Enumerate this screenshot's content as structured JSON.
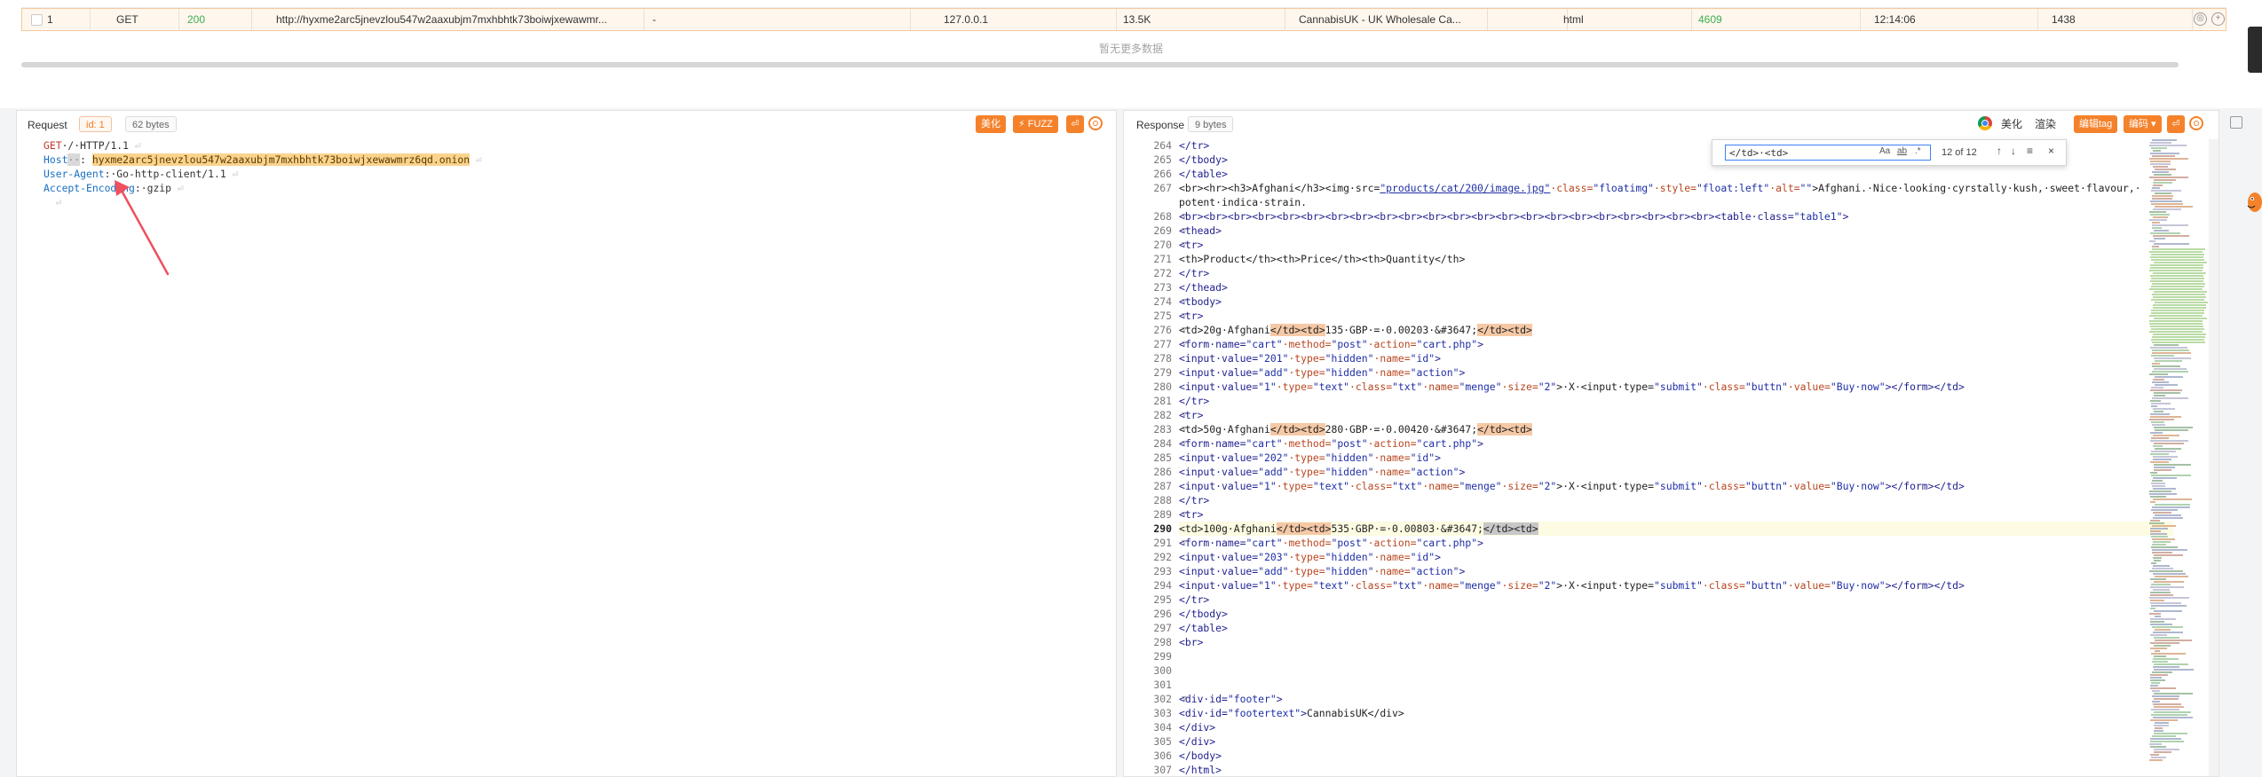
{
  "table": {
    "row": {
      "index": "1",
      "method": "GET",
      "status": "200",
      "url": "http://hyxme2arc5jnevzlou547w2aaxubjm7mxhbhtk73boiwjxewawmr...",
      "extra": "-",
      "ip": "127.0.0.1",
      "size": "13.5K",
      "title": "CannabisUK - UK Wholesale Ca...",
      "content_type": "html",
      "body_len": "4609",
      "time": "12:14:06",
      "duration": "1438"
    },
    "no_more_text": "暂无更多数据"
  },
  "request": {
    "title": "Request",
    "id_tag": "id: 1",
    "size_tag": "62 bytes",
    "beautify": "美化",
    "fuzz": "⚡ FUZZ",
    "lines": {
      "l1_method": "GET",
      "l1_rest": "·/·HTTP/1.1",
      "l2_key": "Host",
      "l2_sep": ":",
      "l2_value": "hyxme2arc5jnevzlou547w2aaxubjm7mxhbhtk73boiwjxewawmrz6qd.onion",
      "l3_key": "User-Agent",
      "l3_value": ":·Go-http-client/1.1",
      "l4_key": "Accept-Encoding",
      "l4_value": ":·gzip"
    }
  },
  "response": {
    "title": "Response",
    "size_tag": "9 bytes",
    "beautify": "美化",
    "render": "渲染",
    "edit_tag": "编辑tag",
    "encode": "编码 ▾",
    "find": {
      "value": "</td>·<td>",
      "case": "Aa",
      "word": "ab",
      "regex": ".*",
      "count": "12 of 12",
      "up": "↑",
      "down": "↓",
      "menu": "≡",
      "close": "×"
    }
  },
  "code_lines": [
    {
      "n": "264",
      "f": "",
      "t": "tag",
      "s": "</tr>"
    },
    {
      "n": "265",
      "f": "",
      "t": "tag",
      "s": "</tbody>"
    },
    {
      "n": "266",
      "f": "",
      "t": "tag",
      "s": "</table>"
    },
    {
      "n": "267",
      "f": "",
      "t": "special267"
    },
    {
      "n": "",
      "f": "",
      "t": "plain",
      "s": "potent·indica·strain."
    },
    {
      "n": "268",
      "f": "v",
      "t": "special268"
    },
    {
      "n": "269",
      "f": "v",
      "t": "tag",
      "s": "<thead>"
    },
    {
      "n": "270",
      "f": "v",
      "t": "tag",
      "s": "<tr>"
    },
    {
      "n": "271",
      "f": "",
      "t": "plain",
      "s": "<th>Product</th><th>Price</th><th>Quantity</th>"
    },
    {
      "n": "272",
      "f": "",
      "t": "tag",
      "s": "</tr>"
    },
    {
      "n": "273",
      "f": "",
      "t": "tag",
      "s": "</thead>"
    },
    {
      "n": "274",
      "f": "v",
      "t": "tag",
      "s": "<tbody>"
    },
    {
      "n": "275",
      "f": "v",
      "t": "tag",
      "s": "<tr>"
    },
    {
      "n": "276",
      "f": "v",
      "t": "td",
      "a": "<td>20g·Afghani",
      "b": "</td><td>",
      "c": "135·GBP·=·0.00203·&#3647;",
      "d": "</td><td>",
      "cur": false
    },
    {
      "n": "277",
      "f": "v",
      "t": "form"
    },
    {
      "n": "278",
      "f": "",
      "t": "hidden",
      "v": "201",
      "nm": "id"
    },
    {
      "n": "279",
      "f": "",
      "t": "hidden",
      "v": "add",
      "nm": "action"
    },
    {
      "n": "280",
      "f": "",
      "t": "text"
    },
    {
      "n": "281",
      "f": "",
      "t": "tag",
      "s": "</tr>"
    },
    {
      "n": "282",
      "f": "v",
      "t": "tag",
      "s": "<tr>"
    },
    {
      "n": "283",
      "f": "v",
      "t": "td",
      "a": "<td>50g·Afghani",
      "b": "</td><td>",
      "c": "280·GBP·=·0.00420·&#3647;",
      "d": "</td><td>",
      "cur": false
    },
    {
      "n": "284",
      "f": "v",
      "t": "form"
    },
    {
      "n": "285",
      "f": "",
      "t": "hidden",
      "v": "202",
      "nm": "id"
    },
    {
      "n": "286",
      "f": "",
      "t": "hidden",
      "v": "add",
      "nm": "action"
    },
    {
      "n": "287",
      "f": "",
      "t": "text"
    },
    {
      "n": "288",
      "f": "",
      "t": "tag",
      "s": "</tr>"
    },
    {
      "n": "289",
      "f": "v",
      "t": "tag",
      "s": "<tr>"
    },
    {
      "n": "290",
      "f": "v",
      "t": "td",
      "a": "<td>100g·Afghani",
      "b": "</td><td>",
      "c": "535·GBP·=·0.00803·&#3647;",
      "d": "</td><td>",
      "cur": true
    },
    {
      "n": "291",
      "f": "v",
      "t": "form"
    },
    {
      "n": "292",
      "f": "",
      "t": "hidden",
      "v": "203",
      "nm": "id"
    },
    {
      "n": "293",
      "f": "",
      "t": "hidden",
      "v": "add",
      "nm": "action"
    },
    {
      "n": "294",
      "f": "",
      "t": "text"
    },
    {
      "n": "295",
      "f": "",
      "t": "tag",
      "s": "</tr>"
    },
    {
      "n": "296",
      "f": "",
      "t": "tag",
      "s": "</tbody>"
    },
    {
      "n": "297",
      "f": "",
      "t": "tag",
      "s": "</table>"
    },
    {
      "n": "298",
      "f": "",
      "t": "tag",
      "s": "<br>"
    },
    {
      "n": "299",
      "f": "",
      "t": "plain",
      "s": ""
    },
    {
      "n": "300",
      "f": "",
      "t": "plain",
      "s": ""
    },
    {
      "n": "301",
      "f": "",
      "t": "plain",
      "s": ""
    },
    {
      "n": "302",
      "f": "v",
      "t": "div",
      "id": "footer",
      "txt": ""
    },
    {
      "n": "303",
      "f": "",
      "t": "div",
      "id": "footertext",
      "txt": "CannabisUK</div>"
    },
    {
      "n": "304",
      "f": "",
      "t": "tag",
      "s": "</div>"
    },
    {
      "n": "305",
      "f": "",
      "t": "tag",
      "s": "</div>"
    },
    {
      "n": "306",
      "f": "",
      "t": "tag",
      "s": "</body>"
    },
    {
      "n": "307",
      "f": "",
      "t": "tag",
      "s": "</html>"
    }
  ],
  "line267": {
    "pre": "<br><hr><h3>Afghani</h3><img·src=",
    "src": "\"products/cat/200/image.jpg\"",
    "post1": "·class=",
    "cls": "\"floatimg\"",
    "post2": "·style=",
    "sty": "\"float:left\"",
    "post3": "·alt=",
    "alt": "\"\"",
    "tail": ">Afghani.·Nice·looking·cyrstally·kush,·sweet·flavour,·"
  },
  "line268": {
    "pre": "<br><br><br><br><br><br><br><br><br><br><br><br><br><br><br><br><br><br><br><br><br><br><table·class=",
    "cls": "\"table1\"",
    "post": ">"
  },
  "form_line": {
    "a": "<form·name=",
    "name": "\"cart\"",
    "b": "·method=",
    "method": "\"post\"",
    "c": "·action=",
    "action": "\"cart.php\"",
    "d": ">"
  },
  "text_line": {
    "a": "<input·value=",
    "v1": "\"1\"",
    "b": "·type=",
    "t1": "\"text\"",
    "c": "·class=",
    "c1": "\"txt\"",
    "d": "·name=",
    "n1": "\"menge\"",
    "e": "·size=",
    "s1": "\"2\"",
    "f": ">·X·<input·type=",
    "t2": "\"submit\"",
    "g": "·class=",
    "c2": "\"buttn\"",
    "h": "·value=",
    "v2": "\"Buy·now\"",
    "i": "></form></td>"
  },
  "colors": {
    "accent": "#f5822b",
    "match": "#f6c9a6",
    "host_highlight": "#fbd38d",
    "status_green": "#3cae4f"
  }
}
